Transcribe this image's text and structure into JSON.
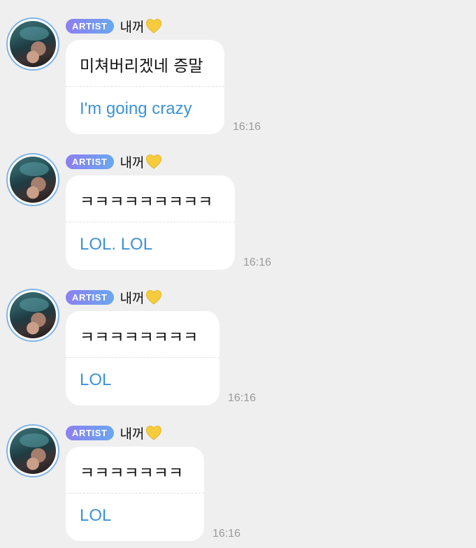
{
  "colors": {
    "background": "#efeff0",
    "bubble": "#ffffff",
    "translation_text": "#3d93d6",
    "badge_gradient_start": "#8c7ff0",
    "badge_gradient_end": "#6aa7ee",
    "timestamp": "#9a9a9a",
    "avatar_ring": "#7fb3e6"
  },
  "messages": [
    {
      "badge": "ARTIST",
      "sender": "내꺼",
      "sender_icon": "yellow-heart-icon",
      "original": "미쳐버리겠네 증말",
      "translation": "I'm going crazy",
      "time": "16:16"
    },
    {
      "badge": "ARTIST",
      "sender": "내꺼",
      "sender_icon": "yellow-heart-icon",
      "original": "ㅋㅋㅋㅋㅋㅋㅋㅋㅋ",
      "translation": "LOL. LOL",
      "time": "16:16"
    },
    {
      "badge": "ARTIST",
      "sender": "내꺼",
      "sender_icon": "yellow-heart-icon",
      "original": "ㅋㅋㅋㅋㅋㅋㅋㅋ",
      "translation": "LOL",
      "time": "16:16"
    },
    {
      "badge": "ARTIST",
      "sender": "내꺼",
      "sender_icon": "yellow-heart-icon",
      "original": "ㅋㅋㅋㅋㅋㅋㅋ",
      "translation": "LOL",
      "time": "16:16"
    }
  ]
}
